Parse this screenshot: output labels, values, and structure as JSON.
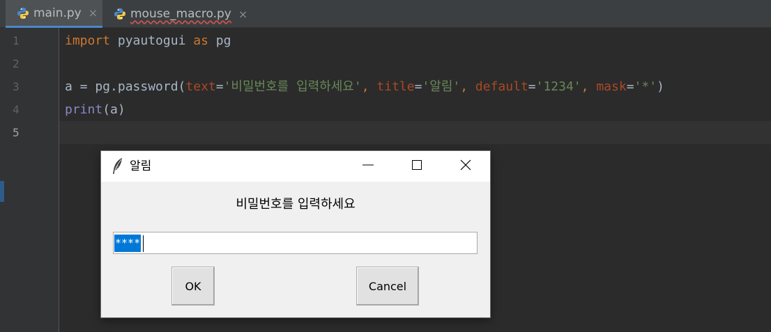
{
  "editor": {
    "tabs": [
      {
        "label": "main.py",
        "close": "×",
        "icon": "python-file-icon",
        "active": true
      },
      {
        "label": "mouse_macro.py",
        "close": "×",
        "icon": "python-file-icon",
        "active": false
      }
    ],
    "line_numbers": [
      "1",
      "2",
      "3",
      "4",
      "5"
    ],
    "current_line": "5",
    "code": {
      "line1": {
        "kw_import": "import",
        "module": " pyautogui ",
        "kw_as": "as",
        "alias": " pg"
      },
      "line3": {
        "prefix": "a = pg.password(",
        "p_text": "text",
        "eq1": "=",
        "s_text": "'비밀번호를 입력하세요'",
        "sep1": ", ",
        "p_title": "title",
        "eq2": "=",
        "s_title": "'알림'",
        "sep2": ", ",
        "p_default": "default",
        "eq3": "=",
        "s_default": "'1234'",
        "sep3": ", ",
        "p_mask": "mask",
        "eq4": "=",
        "s_mask": "'*'",
        "suffix": ")"
      },
      "line4": {
        "builtin": "print",
        "rest": "(a)"
      }
    },
    "colors": {
      "keyword": "#cc7832",
      "builtin": "#8888c6",
      "param": "#aa4926",
      "string": "#6a8759",
      "default_text": "#a9b7c6"
    }
  },
  "dialog": {
    "title": "알림",
    "app_icon": "feather-icon",
    "prompt": "비밀번호를 입력하세요",
    "entry_value": "****",
    "ok_label": "OK",
    "cancel_label": "Cancel",
    "selection_color": "#0078d7"
  }
}
